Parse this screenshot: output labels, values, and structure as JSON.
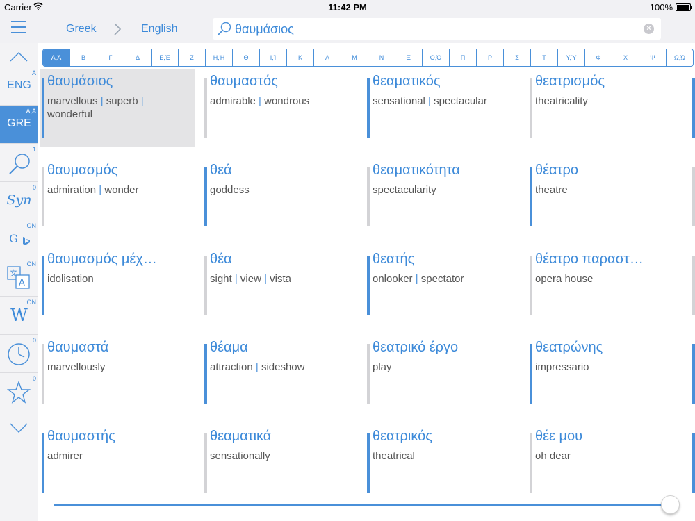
{
  "status": {
    "carrier": "Carrier",
    "time": "11:42 PM",
    "battery": "100%"
  },
  "nav": {
    "from_lang": "Greek",
    "arrow": ">",
    "to_lang": "English",
    "search_value": "θαυμάσιος"
  },
  "sidebar": {
    "items": [
      {
        "label": "ENG",
        "corner": "A"
      },
      {
        "label": "GRE",
        "corner": "A,A"
      },
      {
        "icon": "search-icon",
        "corner": "1"
      },
      {
        "label": "Syn",
        "corner": "0"
      },
      {
        "icon": "google-bing-icon",
        "corner": "ON",
        "label": "G"
      },
      {
        "icon": "translate-icon",
        "corner": "ON"
      },
      {
        "label": "W",
        "corner": "ON"
      },
      {
        "icon": "clock-icon",
        "corner": "0"
      },
      {
        "icon": "star-icon",
        "corner": "0"
      }
    ]
  },
  "alphabet": [
    "Α,Ά",
    "Β",
    "Γ",
    "Δ",
    "Ε,Έ",
    "Ζ",
    "Η,Ή",
    "Θ",
    "Ι,Ί",
    "Κ",
    "Λ",
    "Μ",
    "Ν",
    "Ξ",
    "Ο,Ό",
    "Π",
    "Ρ",
    "Σ",
    "Τ",
    "Υ,Ύ",
    "Φ",
    "Χ",
    "Ψ",
    "Ω,Ώ"
  ],
  "alphabet_active": 0,
  "results": [
    {
      "word": "θαυμάσιος",
      "translations": [
        "marvellous",
        "superb",
        "wonderful"
      ],
      "accent": true,
      "selected": true
    },
    {
      "word": "θαυμαστός",
      "translations": [
        "admirable",
        "wondrous"
      ],
      "accent": false
    },
    {
      "word": "θεαματικός",
      "translations": [
        "sensational",
        "spectacular"
      ],
      "accent": true
    },
    {
      "word": "θεατρισμός",
      "translations": [
        "theatricality"
      ],
      "accent": false
    },
    {
      "word": "θαυμασμός",
      "translations": [
        "admiration",
        "wonder"
      ],
      "accent": false
    },
    {
      "word": "θεά",
      "translations": [
        "goddess"
      ],
      "accent": true
    },
    {
      "word": "θεαματικότητα",
      "translations": [
        "spectacularity"
      ],
      "accent": false
    },
    {
      "word": "θέατρο",
      "translations": [
        "theatre"
      ],
      "accent": true
    },
    {
      "word": "θαυμασμός μέχ…",
      "translations": [
        "idolisation"
      ],
      "accent": true
    },
    {
      "word": "θέα",
      "translations": [
        "sight",
        "view",
        "vista"
      ],
      "accent": false
    },
    {
      "word": "θεατής",
      "translations": [
        "onlooker",
        "spectator"
      ],
      "accent": true
    },
    {
      "word": "θέατρο παραστ…",
      "translations": [
        "opera house"
      ],
      "accent": false
    },
    {
      "word": "θαυμαστά",
      "translations": [
        "marvellously"
      ],
      "accent": false
    },
    {
      "word": "θέαμα",
      "translations": [
        "attraction",
        "sideshow"
      ],
      "accent": true
    },
    {
      "word": "θεατρικό έργο",
      "translations": [
        "play"
      ],
      "accent": false
    },
    {
      "word": "θεατρώνης",
      "translations": [
        "impressario"
      ],
      "accent": true
    },
    {
      "word": "θαυμαστής",
      "translations": [
        "admirer"
      ],
      "accent": true
    },
    {
      "word": "θεαματικά",
      "translations": [
        "sensationally"
      ],
      "accent": false
    },
    {
      "word": "θεατρικός",
      "translations": [
        "theatrical"
      ],
      "accent": true
    },
    {
      "word": "θέε μου",
      "translations": [
        "oh dear"
      ],
      "accent": false
    }
  ],
  "edge_accents": [
    true,
    false,
    false,
    true,
    true
  ],
  "colors": {
    "accent": "#4a90d9",
    "inactive_bar": "#d3d3d6",
    "selected_bg": "#e4e4e6"
  }
}
